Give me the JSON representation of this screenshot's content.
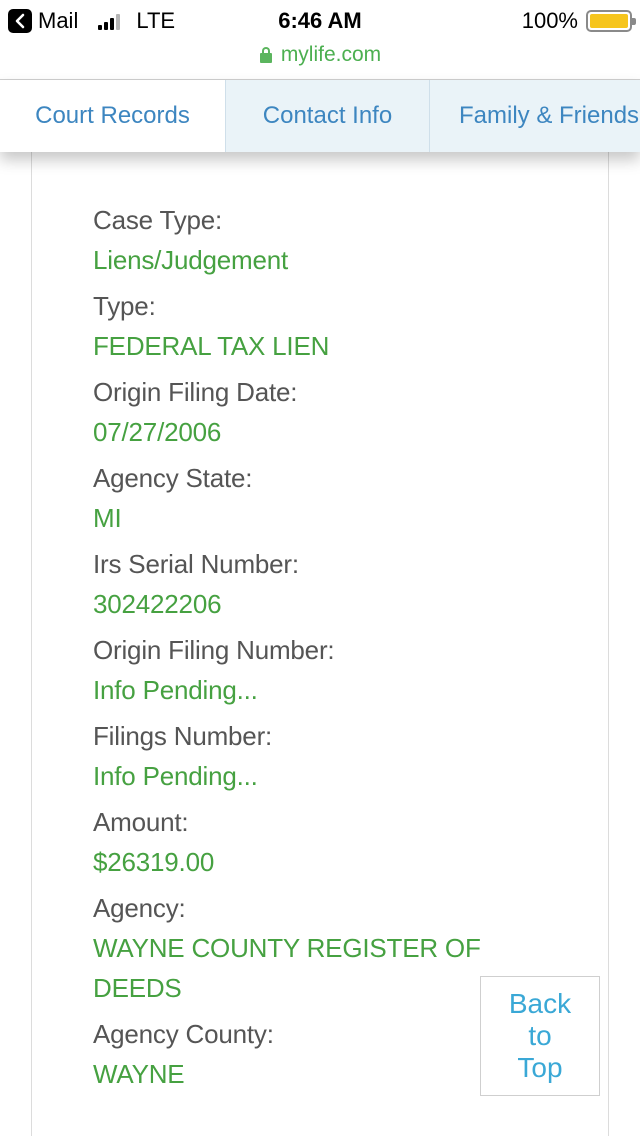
{
  "status_bar": {
    "back_app": "Mail",
    "carrier": "LTE",
    "time": "6:46 AM",
    "battery": "100%",
    "signal_bars": 4,
    "signal_active": 3,
    "battery_color": "#f6c51d"
  },
  "url": "mylife.com",
  "tabs": [
    {
      "label": "Court Records",
      "active": true
    },
    {
      "label": "Contact Info",
      "active": false
    },
    {
      "label": "Family & Friends",
      "active": false
    }
  ],
  "record": {
    "fields": [
      {
        "label": "Case Type:",
        "value": "Liens/Judgement"
      },
      {
        "label": "Type:",
        "value": "FEDERAL TAX LIEN"
      },
      {
        "label": "Origin Filing Date:",
        "value": "07/27/2006"
      },
      {
        "label": "Agency State:",
        "value": "MI"
      },
      {
        "label": "Irs Serial Number:",
        "value": "302422206"
      },
      {
        "label": "Origin Filing Number:",
        "value": "Info Pending..."
      },
      {
        "label": "Filings Number:",
        "value": "Info Pending..."
      },
      {
        "label": "Amount:",
        "value": "$26319.00"
      },
      {
        "label": "Agency:",
        "value": "WAYNE COUNTY REGISTER OF DEEDS"
      },
      {
        "label": "Agency County:",
        "value": "WAYNE"
      }
    ]
  },
  "back_to_top": {
    "line1": "Back",
    "line2": "to",
    "line3": "Top"
  },
  "colors": {
    "link_blue": "#3d86c0",
    "value_green": "#46a141",
    "label_gray": "#555555",
    "back_to_top_blue": "#3aa8d6"
  }
}
